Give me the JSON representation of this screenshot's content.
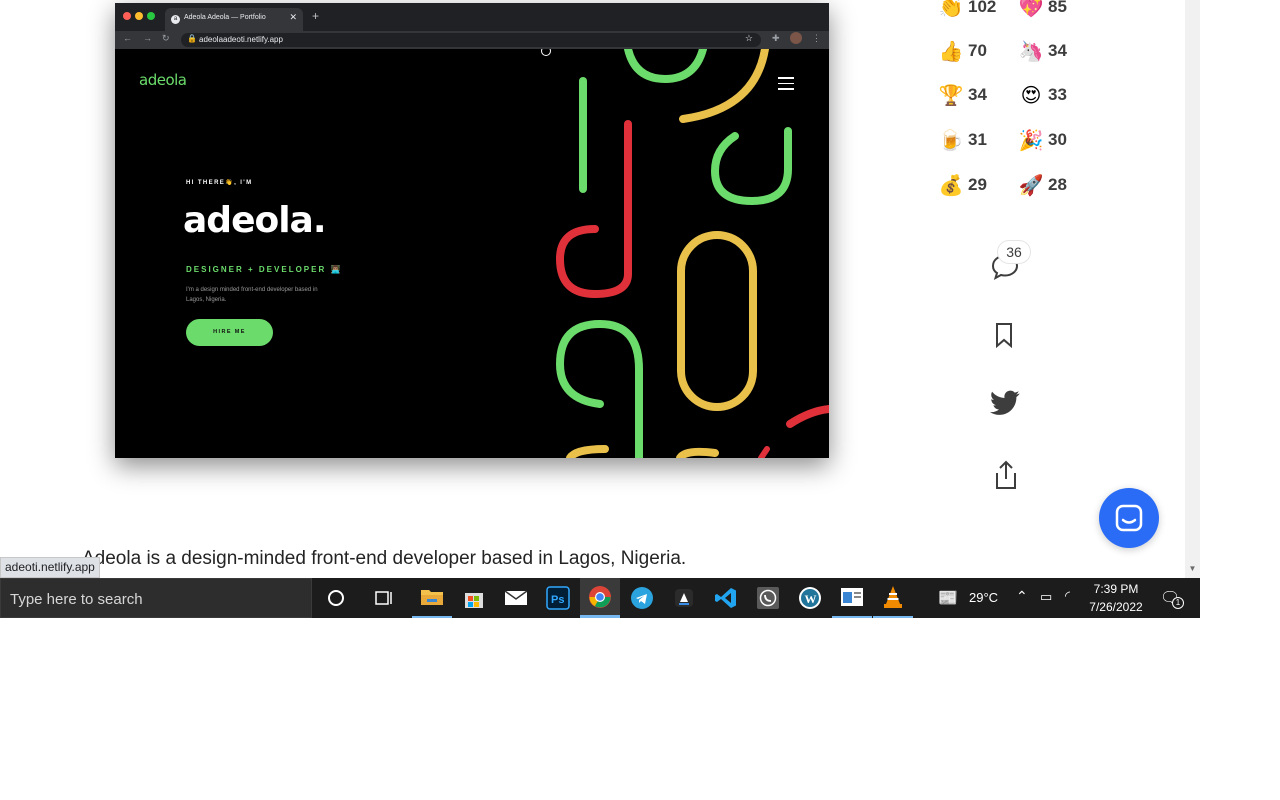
{
  "embedded_browser": {
    "tab_title": "Adeola Adeola — Portfolio",
    "url": "adeolaadeoti.netlify.app",
    "site": {
      "logo": "adeola",
      "greeting": "HI THERE👋, I'M",
      "name": "adeola.",
      "role": "DESIGNER + DEVELOPER 👨🏽‍💻",
      "description": "I'm a design minded front-end developer based in Lagos, Nigeria.",
      "cta": "HIRE ME"
    }
  },
  "reactions": [
    {
      "icon": "clapping-hands-icon",
      "emoji": "👏",
      "count": "102"
    },
    {
      "icon": "heart-icon",
      "emoji": "💖",
      "count": "85"
    },
    {
      "icon": "thumbs-up-icon",
      "emoji": "👍",
      "count": "70"
    },
    {
      "icon": "unicorn-icon",
      "emoji": "🦄",
      "count": "34"
    },
    {
      "icon": "trophy-icon",
      "emoji": "🏆",
      "count": "34"
    },
    {
      "icon": "heart-eyes-icon",
      "emoji": "😍",
      "count": "33"
    },
    {
      "icon": "beer-icon",
      "emoji": "🍺",
      "count": "31"
    },
    {
      "icon": "party-popper-icon",
      "emoji": "🎉",
      "count": "30"
    },
    {
      "icon": "money-bag-icon",
      "emoji": "💰",
      "count": "29"
    },
    {
      "icon": "rocket-icon",
      "emoji": "🚀",
      "count": "28"
    }
  ],
  "comments": {
    "count": "36"
  },
  "article": {
    "first_sentence": "Adeola is a design-minded front-end developer based in Lagos, Nigeria."
  },
  "status_bar": {
    "hover_url": "adeoti.netlify.app"
  },
  "taskbar": {
    "search_placeholder": "Type here to search",
    "weather": "29°C",
    "time": "7:39 PM",
    "date": "7/26/2022",
    "notification_count": "1"
  },
  "colors": {
    "accent_green": "#6bdc6b",
    "accent_red": "#e0303a",
    "accent_yellow": "#e9c04a",
    "chat_fab": "#2b6cf6"
  }
}
